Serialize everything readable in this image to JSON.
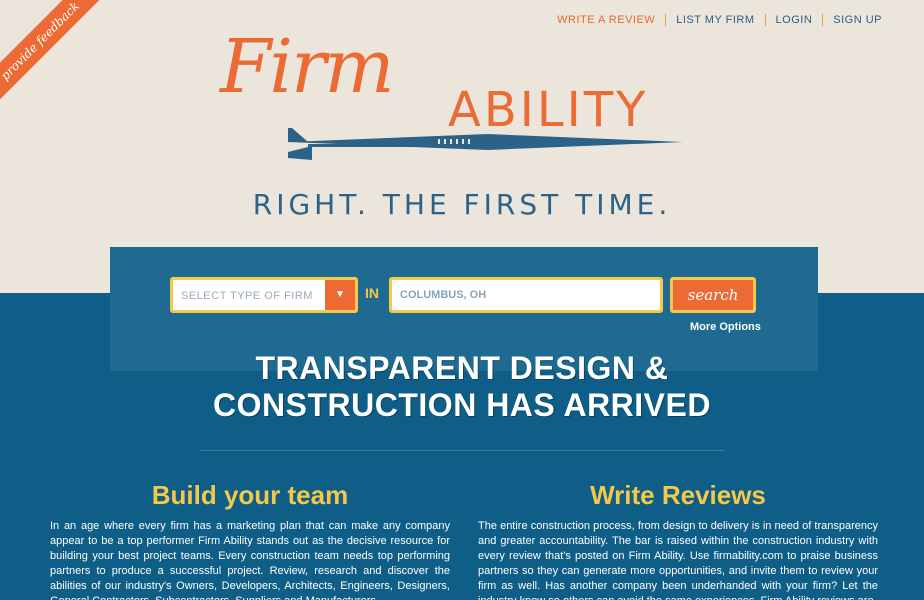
{
  "feedback_ribbon": "provide feedback",
  "nav": {
    "write_review": "WRITE A REVIEW",
    "list_firm": "LIST MY FIRM",
    "login": "LOGIN",
    "signup": "SIGN UP"
  },
  "logo": {
    "firm": "Firm",
    "ability": "ABILITY"
  },
  "tagline": "RIGHT. THE FIRST TIME.",
  "search": {
    "select_placeholder": "SELECT TYPE OF FIRM",
    "in_label": "IN",
    "location_value": "COLUMBUS, OH",
    "button_label": "search",
    "more_options": "More Options"
  },
  "headline": {
    "line1": "TRANSPARENT DESIGN &",
    "line2": "CONSTRUCTION HAS ARRIVED"
  },
  "sections": {
    "build": {
      "title": "Build your team",
      "body": "In an age where every firm has a marketing plan that can make any company appear to be a top performer Firm Ability stands out as the decisive resource for building your best project teams. Every construction team needs top performing partners to produce a successful project. Review, research and discover the abilities of our industry's Owners, Developers, Architects, Engineers, Designers, General Contractors, Subcontractors, Suppliers and Manufacturers."
    },
    "reviews": {
      "title": "Write Reviews",
      "body": "The entire construction process, from design to delivery is in need of transparency and greater accountability. The bar is raised within the construction industry with every review that's posted on Firm Ability. Use firmability.com to praise business partners so they can generate more opportunities, and invite them to review your firm as well. Has another company been underhanded with your firm? Let the industry know so others can avoid the same experiences. Firm Ability reviews are"
    }
  },
  "colors": {
    "orange": "#ec6a33",
    "blue": "#0f5e87",
    "yellow": "#f4c84a",
    "cream": "#ebe5dc"
  }
}
